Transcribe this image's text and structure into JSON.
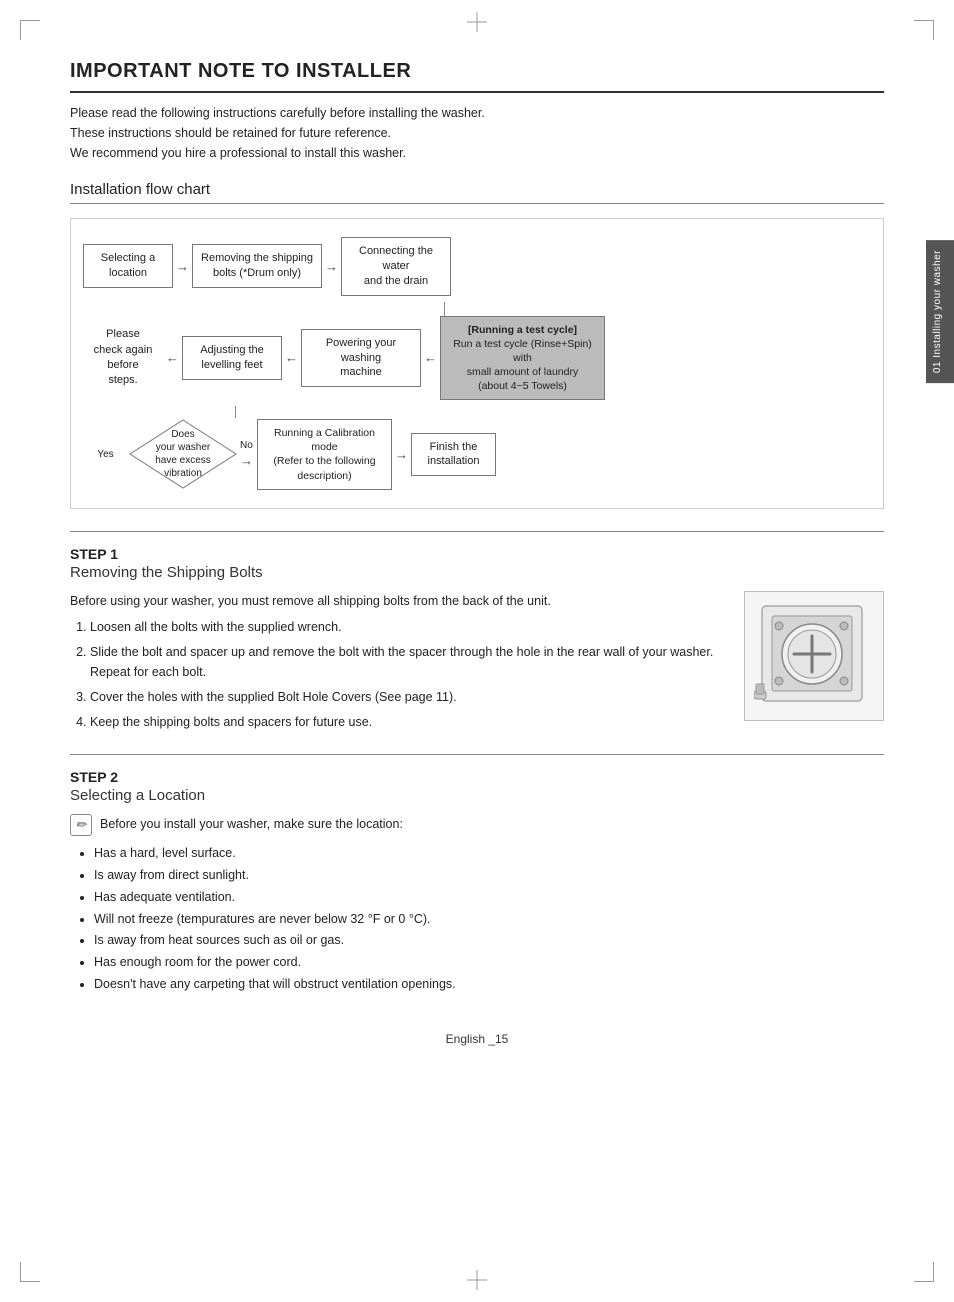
{
  "page": {
    "title": "IMPORTANT NOTE TO INSTALLER",
    "intro_lines": [
      "Please read the following instructions carefully before installing the washer.",
      "These instructions should be retained for future reference.",
      "We recommend you hire a professional to install this washer."
    ],
    "flow_chart_title": "Installation flow chart",
    "flow_chart": {
      "row1": [
        {
          "label": "Selecting a\nlocation",
          "type": "box"
        },
        {
          "type": "arrow"
        },
        {
          "label": "Removing the shipping\nbolts (*Drum only)",
          "type": "box"
        },
        {
          "type": "arrow"
        },
        {
          "label": "Connecting the water\nand the drain",
          "type": "box"
        }
      ],
      "row2": [
        {
          "label": "Please\ncheck again\nbefore\nsteps.",
          "type": "box-plain"
        },
        {
          "type": "arrow"
        },
        {
          "label": "Adjusting the\nlevelling feet",
          "type": "box"
        },
        {
          "type": "arrow"
        },
        {
          "label": "Powering your washing\nmachine",
          "type": "box"
        },
        {
          "type": "arrow"
        },
        {
          "label": "[Running a test cycle]\nRun a test cycle (Rinse+Spin) with\nsmall amount of laundry\n(about 4~5 Towels)",
          "type": "box-dark"
        }
      ],
      "row3": [
        {
          "label": "Yes",
          "type": "label"
        },
        {
          "label": "Does\nyour washer\nhave excess vibration\nor noise?",
          "type": "diamond"
        },
        {
          "label": "No",
          "type": "label"
        },
        {
          "type": "arrow"
        },
        {
          "label": "Running a Calibration mode\n(Refer to the following\ndescription)",
          "type": "box"
        },
        {
          "type": "arrow"
        },
        {
          "label": "Finish the\ninstallation",
          "type": "box"
        }
      ]
    },
    "step1": {
      "number": "STEP 1",
      "title": "Removing the Shipping Bolts",
      "intro": "Before using your washer, you must remove all shipping bolts from the back of the unit.",
      "steps": [
        "Loosen all the bolts with the supplied wrench.",
        "Slide the bolt and spacer up and remove the bolt with the spacer through the hole in the rear wall of your washer. Repeat for each bolt.",
        "Cover the holes with the supplied Bolt Hole Covers (See page 11).",
        "Keep the shipping bolts and spacers for future use."
      ]
    },
    "step2": {
      "number": "STEP 2",
      "title": "Selecting a Location",
      "note": "Before you install your washer, make sure the location:",
      "bullets": [
        "Has a hard, level surface.",
        "Is away from direct sunlight.",
        "Has adequate ventilation.",
        "Will not freeze (tempuratures are never below 32 °F or 0 °C).",
        "Is away from heat sources such as oil or gas.",
        "Has enough room for the power cord.",
        "Doesn't have any carpeting that will obstruct ventilation openings."
      ]
    },
    "footer": "English _15",
    "side_tab": "01 Installing your washer"
  }
}
